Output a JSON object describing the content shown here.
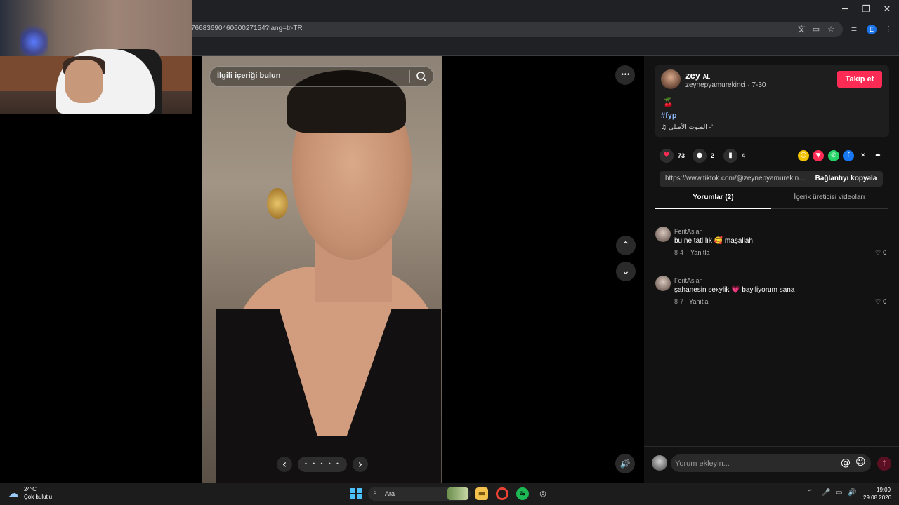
{
  "browser": {
    "url": "7668369046060027154?lang=tr-TR",
    "window_controls": [
      "─",
      "❐",
      "✕"
    ],
    "profile_initial": "E"
  },
  "video": {
    "search_placeholder": "İlgili içeriği bulun",
    "more_glyph": "•••",
    "up_glyph": "⌃",
    "down_glyph": "⌄",
    "prev_glyph": "‹",
    "next_glyph": "›",
    "dots": "• • • • •",
    "volume_glyph": "🔊"
  },
  "creator": {
    "name": "zey",
    "name_suffix": "AL",
    "handle_meta": "zeynepyamurekinci · 7-30",
    "follow_label": "Takip et",
    "emoji": "🍒",
    "hashtag": "#fyp",
    "sound": "♫ الصوت الأصلي -'"
  },
  "stats": {
    "likes": "73",
    "comments": "2",
    "saves": "4"
  },
  "share_icons": [
    "☺",
    "▼",
    "✆",
    "f",
    "✕",
    "➦"
  ],
  "link": {
    "url": "https://www.tiktok.com/@zeynepyamurekinci...",
    "copy_label": "Bağlantıyı kopyala"
  },
  "tabs": {
    "comments": "Yorumlar (2)",
    "creator_videos": "İçerik üreticisi videoları"
  },
  "comments": [
    {
      "user": "FeritAslan",
      "text": "bu ne tatlılık 🥰 maşallah",
      "date": "8-4",
      "reply": "Yanıtla",
      "likes": "♡ 0"
    },
    {
      "user": "FeritAslan",
      "text": "şahanesin sexylik 💗 bayiliyorum sana",
      "date": "8-7",
      "reply": "Yanıtla",
      "likes": "♡ 0"
    }
  ],
  "comment_input": {
    "placeholder": "Yorum ekleyin..."
  },
  "taskbar": {
    "temp": "24°C",
    "weather": "Çok bulutlu",
    "search": "Ara",
    "time": "19:09",
    "date": "29.08.2026"
  },
  "colors": {
    "accent": "#fe2c55",
    "panel": "#121212"
  }
}
